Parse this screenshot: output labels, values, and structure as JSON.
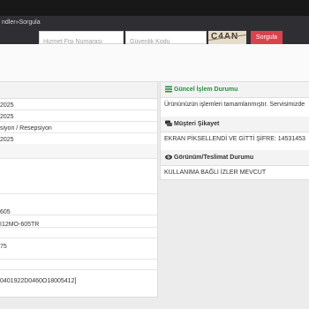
{
  "breadcrumb": "ndler»Sorgula",
  "query": {
    "service_slip_placeholder": "Hizmet Fişi Numarası",
    "security_code_placeholder": "Güvenlik Kodu",
    "captcha_text": "C4AN",
    "submit_label": "Sorgula"
  },
  "left_rows": [
    "2025",
    "2025",
    "siyon / Resepsiyon",
    "2025",
    "",
    "",
    "605",
    "I12MO-605TR",
    "",
    "75",
    "",
    "0401922D0460O18005412]"
  ],
  "right": {
    "status_title": "Güncel İşlem Durumu",
    "status_text": "Ürününüzün işlemleri tamamlanmıştır. Servisimizde",
    "complaint_title": "Müşteri Şikayet",
    "complaint_text": "EKRAN PİKSELLENDİ VE GİTTİ ŞİFRE: 14531453",
    "appearance_title": "Görünüm/Teslimat Durumu",
    "appearance_text": "KULLANIMA BAĞLI İZLER MEVCUT"
  },
  "colors": {
    "accent_green": "#2e8b3e",
    "button_red": "#d9434e"
  },
  "icons": {
    "status": "list-icon",
    "complaint": "comments-icon",
    "appearance": "eye-icon"
  }
}
